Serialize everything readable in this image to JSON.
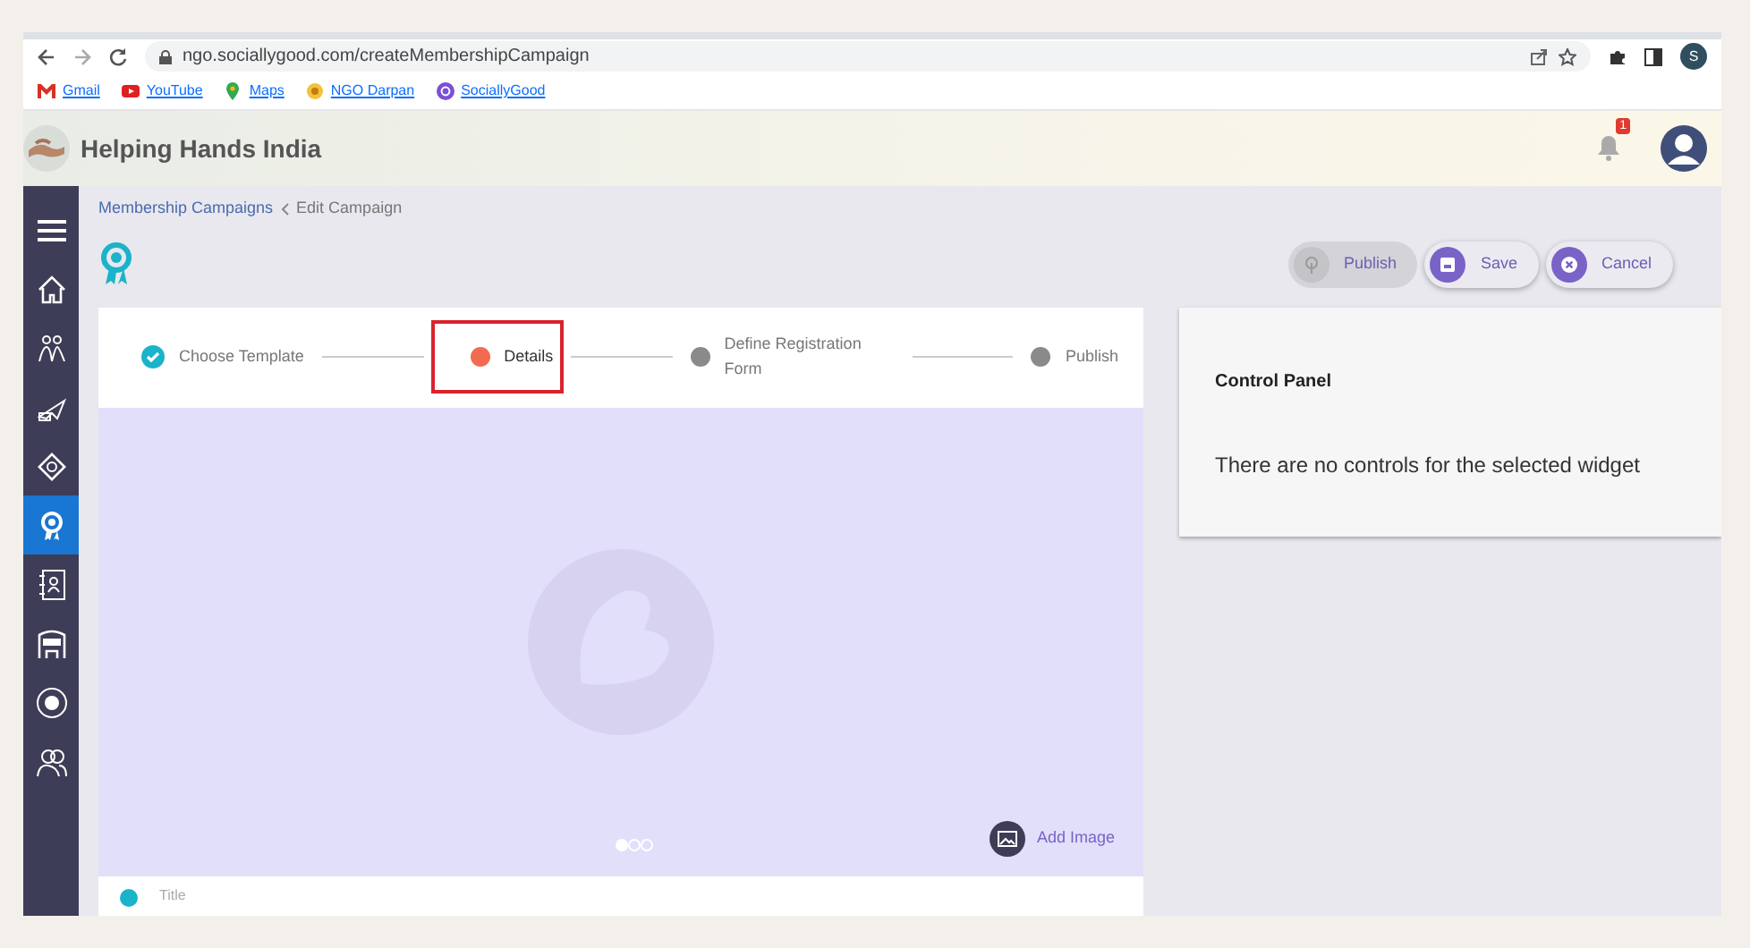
{
  "browser": {
    "url": "ngo.sociallygood.com/createMembershipCampaign",
    "bookmarks": [
      "Gmail",
      "YouTube",
      "Maps",
      "NGO Darpan",
      "SociallyGood"
    ],
    "profile_initial": "S"
  },
  "header": {
    "title": "Helping Hands India",
    "notification_count": "1"
  },
  "sidebar": {
    "items": [
      {
        "selected": false
      },
      {
        "selected": false
      },
      {
        "selected": false
      },
      {
        "selected": false
      },
      {
        "selected": true
      },
      {
        "selected": false
      },
      {
        "selected": false
      },
      {
        "selected": false
      },
      {
        "selected": false
      }
    ]
  },
  "breadcrumb": [
    {
      "label": "Membership Campaigns",
      "link": true
    },
    {
      "label": "Edit Campaign",
      "link": false
    }
  ],
  "actions": [
    {
      "label": "Publish",
      "disabled": true
    },
    {
      "label": "Save",
      "disabled": false
    },
    {
      "label": "Cancel",
      "disabled": false
    }
  ],
  "steps": [
    {
      "label": "Choose Template",
      "completed": true,
      "selected": false,
      "highlighted": false
    },
    {
      "label": "Details",
      "completed": false,
      "selected": true,
      "highlighted": true
    },
    {
      "label": "Define Registration Form",
      "completed": false,
      "selected": false,
      "highlighted": false
    },
    {
      "label": "Publish",
      "completed": false,
      "selected": false,
      "highlighted": false
    }
  ],
  "carousel": {
    "dots": [
      {
        "selected": true
      },
      {
        "selected": false
      },
      {
        "selected": false
      }
    ],
    "add_image": "Add Image"
  },
  "title_field": {
    "placeholder": "Title"
  },
  "control_panel": {
    "title": "Control Panel",
    "message": "There are no controls for the selected widget"
  }
}
